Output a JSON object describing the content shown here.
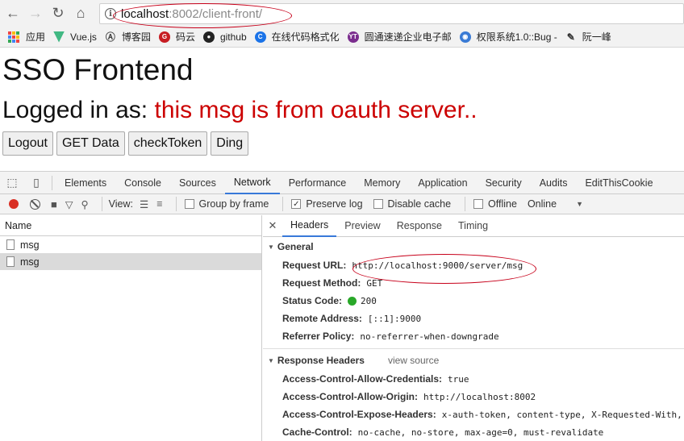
{
  "browser": {
    "url_host": "localhost",
    "url_rest": ":8002/client-front/"
  },
  "bookmarks": [
    {
      "label": "应用",
      "color": "#e44"
    },
    {
      "label": "Vue.js",
      "color": "#41b883"
    },
    {
      "label": "博客园",
      "color": "#555"
    },
    {
      "label": "码云",
      "color": "#c71d23"
    },
    {
      "label": "github",
      "color": "#222"
    },
    {
      "label": "在线代码格式化",
      "color": "#1a73e8"
    },
    {
      "label": "圆通速递企业电子邮",
      "color": "#7b2d8e"
    },
    {
      "label": "权限系统1.0::Bug -",
      "color": "#3a7bd5"
    },
    {
      "label": "阮一峰",
      "color": "#444"
    }
  ],
  "page": {
    "title": "SSO Frontend",
    "logged_prefix": "Logged in as: ",
    "logged_msg": "this msg is from oauth server..",
    "buttons": [
      "Logout",
      "GET Data",
      "checkToken",
      "Ding"
    ]
  },
  "devtools": {
    "tabs": [
      "Elements",
      "Console",
      "Sources",
      "Network",
      "Performance",
      "Memory",
      "Application",
      "Security",
      "Audits",
      "EditThisCookie"
    ],
    "active_tab": "Network",
    "view_label": "View:",
    "group_by_frame": "Group by frame",
    "preserve_log": "Preserve log",
    "disable_cache": "Disable cache",
    "offline": "Offline",
    "throttle": "Online",
    "name_header": "Name",
    "requests": [
      "msg",
      "msg"
    ],
    "detail_tabs": [
      "Headers",
      "Preview",
      "Response",
      "Timing"
    ],
    "general_title": "General",
    "general": [
      {
        "k": "Request URL:",
        "v": "http://localhost:9000/server/msg"
      },
      {
        "k": "Request Method:",
        "v": "GET"
      },
      {
        "k": "Status Code:",
        "v": "200"
      },
      {
        "k": "Remote Address:",
        "v": "[::1]:9000"
      },
      {
        "k": "Referrer Policy:",
        "v": "no-referrer-when-downgrade"
      }
    ],
    "response_title": "Response Headers",
    "view_source": "view source",
    "response": [
      {
        "k": "Access-Control-Allow-Credentials:",
        "v": "true"
      },
      {
        "k": "Access-Control-Allow-Origin:",
        "v": "http://localhost:8002"
      },
      {
        "k": "Access-Control-Expose-Headers:",
        "v": "x-auth-token, content-type, X-Requested-With, X"
      },
      {
        "k": "Cache-Control:",
        "v": "no-cache, no-store, max-age=0, must-revalidate"
      }
    ]
  }
}
